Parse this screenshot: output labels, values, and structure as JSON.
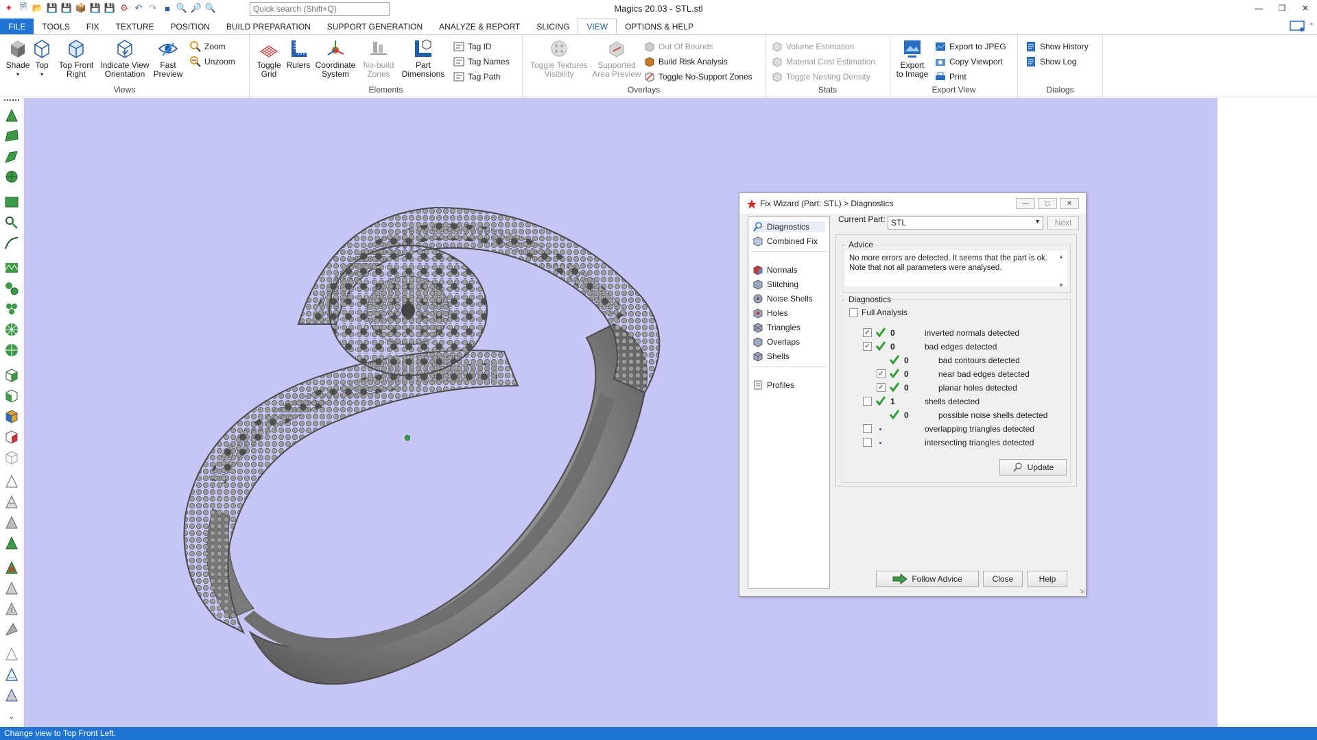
{
  "window": {
    "title": "Magics 20.03 - STL.stl",
    "search_placeholder": "Quick search (Shift+Q)"
  },
  "tabs": [
    {
      "label": "FILE"
    },
    {
      "label": "TOOLS"
    },
    {
      "label": "FIX"
    },
    {
      "label": "TEXTURE"
    },
    {
      "label": "POSITION"
    },
    {
      "label": "BUILD PREPARATION"
    },
    {
      "label": "SUPPORT GENERATION"
    },
    {
      "label": "ANALYZE & REPORT"
    },
    {
      "label": "SLICING"
    },
    {
      "label": "VIEW"
    },
    {
      "label": "OPTIONS & HELP"
    }
  ],
  "ribbon": {
    "views": {
      "label": "Views",
      "shade": "Shade",
      "top": "Top",
      "top_front_right_1": "Top Front",
      "top_front_right_2": "Right",
      "indicate_1": "Indicate View",
      "indicate_2": "Orientation",
      "fast_1": "Fast",
      "fast_2": "Preview",
      "zoom": "Zoom",
      "unzoom": "Unzoom"
    },
    "elements": {
      "label": "Elements",
      "toggle_grid_1": "Toggle",
      "toggle_grid_2": "Grid",
      "rulers": "Rulers",
      "coord_1": "Coordinate",
      "coord_2": "System",
      "nobuild_1": "No-build",
      "nobuild_2": "Zones",
      "partdim_1": "Part",
      "partdim_2": "Dimensions",
      "tag_id": "Tag ID",
      "tag_names": "Tag Names",
      "tag_path": "Tag Path"
    },
    "overlays": {
      "label": "Overlays",
      "toggle_tex_1": "Toggle Textures",
      "toggle_tex_2": "Visibility",
      "supported_1": "Supported",
      "supported_2": "Area Preview",
      "out_of_bounds": "Out Of Bounds",
      "build_risk": "Build Risk Analysis",
      "toggle_nosupport": "Toggle No-Support Zones"
    },
    "stats": {
      "label": "Stats",
      "volume": "Volume Estimation",
      "material": "Material Cost Estimation",
      "nesting": "Toggle Nesting Density"
    },
    "export_view": {
      "label": "Export View",
      "export_img_1": "Export",
      "export_img_2": "to Image",
      "export_jpeg": "Export to JPEG",
      "copy_viewport": "Copy Viewport",
      "print": "Print"
    },
    "dialogs": {
      "label": "Dialogs",
      "show_history": "Show History",
      "show_log": "Show Log"
    }
  },
  "dialog": {
    "title": "Fix Wizard (Part: STL) > Diagnostics",
    "nav": [
      {
        "label": "Diagnostics"
      },
      {
        "label": "Combined Fix"
      },
      {
        "label": "Normals"
      },
      {
        "label": "Stitching"
      },
      {
        "label": "Noise Shells"
      },
      {
        "label": "Holes"
      },
      {
        "label": "Triangles"
      },
      {
        "label": "Overlaps"
      },
      {
        "label": "Shells"
      },
      {
        "label": "Profiles"
      }
    ],
    "current_part_label": "Current Part:",
    "current_part_value": "STL",
    "next_label": "Next",
    "advice_label": "Advice",
    "advice_text": "No more errors are detected. It seems that the part is ok. Note that not all parameters were analysed.",
    "diagnostics_label": "Diagnostics",
    "full_analysis_label": "Full Analysis",
    "rows": [
      {
        "count": "0",
        "text": "inverted normals detected",
        "checked": true
      },
      {
        "count": "0",
        "text": "bad edges detected",
        "checked": true
      },
      {
        "count": "0",
        "text": "bad contours detected"
      },
      {
        "count": "0",
        "text": "near bad edges detected",
        "checked": true
      },
      {
        "count": "0",
        "text": "planar holes detected",
        "checked": true
      },
      {
        "count": "1",
        "text": "shells detected",
        "checked": false
      },
      {
        "count": "0",
        "text": "possible noise shells detected"
      },
      {
        "count": "",
        "text": "overlapping triangles detected",
        "checked": false
      },
      {
        "count": "",
        "text": "intersecting triangles detected",
        "checked": false
      }
    ],
    "update_label": "Update",
    "follow_advice_label": "Follow Advice",
    "close_label": "Close",
    "help_label": "Help"
  },
  "status": {
    "text": "Change view to Top Front Left."
  },
  "colors": {
    "viewport_bg": "#c6c6f6",
    "accent": "#1f74d3",
    "ring_metal": "#8a8a8a",
    "check_green": "#2f9e36"
  }
}
